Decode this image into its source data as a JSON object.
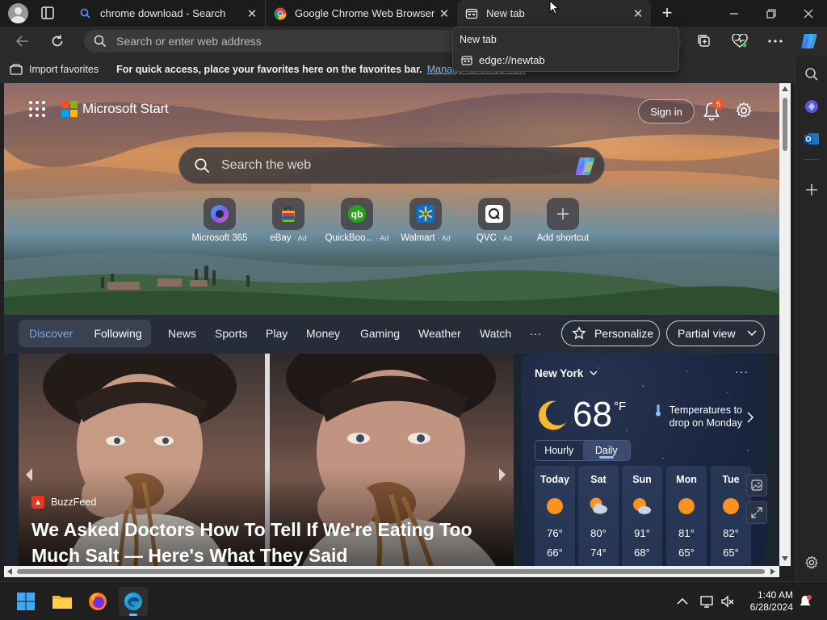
{
  "tabs": [
    {
      "title": "chrome download - Search",
      "favicon": "bing-search-icon",
      "active": false
    },
    {
      "title": "Google Chrome Web Browser",
      "favicon": "chrome-logo-icon",
      "active": false
    },
    {
      "title": "New tab",
      "favicon": "newtab-page-icon",
      "active": true
    }
  ],
  "address_bar": {
    "placeholder": "Search or enter web address"
  },
  "favorites_bar": {
    "import_label": "Import favorites",
    "hint": "For quick access, place your favorites here on the favorites bar.",
    "manage_link": "Manage favorites now"
  },
  "tooltip": {
    "title": "New tab",
    "url": "edge://newtab"
  },
  "page": {
    "brand": "Microsoft Start",
    "sign_in": "Sign in",
    "notifications_count": "5",
    "search_placeholder": "Search the web",
    "shortcuts": [
      {
        "label": "Microsoft 365",
        "ad": "",
        "icon": "microsoft-365-icon"
      },
      {
        "label": "eBay",
        "ad": "· Ad",
        "icon": "ebay-icon"
      },
      {
        "label": "QuickBoo...",
        "ad": "· Ad",
        "icon": "quickbooks-icon"
      },
      {
        "label": "Walmart",
        "ad": "· Ad",
        "icon": "walmart-icon"
      },
      {
        "label": "QVC",
        "ad": "· Ad",
        "icon": "qvc-icon"
      },
      {
        "label": "Add shortcut",
        "ad": "",
        "icon": "plus-icon"
      }
    ]
  },
  "feed_nav": {
    "toggle": [
      "Discover",
      "Following"
    ],
    "links": [
      "News",
      "Sports",
      "Play",
      "Money",
      "Gaming",
      "Weather",
      "Watch",
      "···"
    ],
    "personalize": "Personalize",
    "view_mode": "Partial view"
  },
  "article": {
    "source": "BuzzFeed",
    "headline": "We Asked Doctors How To Tell If We're Eating Too Much Salt — Here's What They Said"
  },
  "weather": {
    "location": "New York",
    "more": "···",
    "temperature": "68",
    "unit": "°F",
    "note": "Temperatures to drop on Monday",
    "tabs": [
      "Hourly",
      "Daily"
    ],
    "active_tab": "Daily",
    "forecast": [
      {
        "day": "Today",
        "icon": "sun-icon",
        "high": "76°",
        "low": "66°"
      },
      {
        "day": "Sat",
        "icon": "partly-cloudy-icon",
        "high": "80°",
        "low": "74°"
      },
      {
        "day": "Sun",
        "icon": "partly-cloudy-icon",
        "high": "91°",
        "low": "68°"
      },
      {
        "day": "Mon",
        "icon": "sun-icon",
        "high": "81°",
        "low": "65°"
      },
      {
        "day": "Tue",
        "icon": "sun-icon",
        "high": "82°",
        "low": "65°"
      }
    ]
  },
  "taskbar": {
    "time": "1:40 AM",
    "date": "6/28/2024"
  },
  "colors": {
    "accent_link": "#7fb3ff",
    "discover_active": "#72a9f5",
    "badge": "#e6572c",
    "edge_indicator": "#7ab3ff"
  }
}
